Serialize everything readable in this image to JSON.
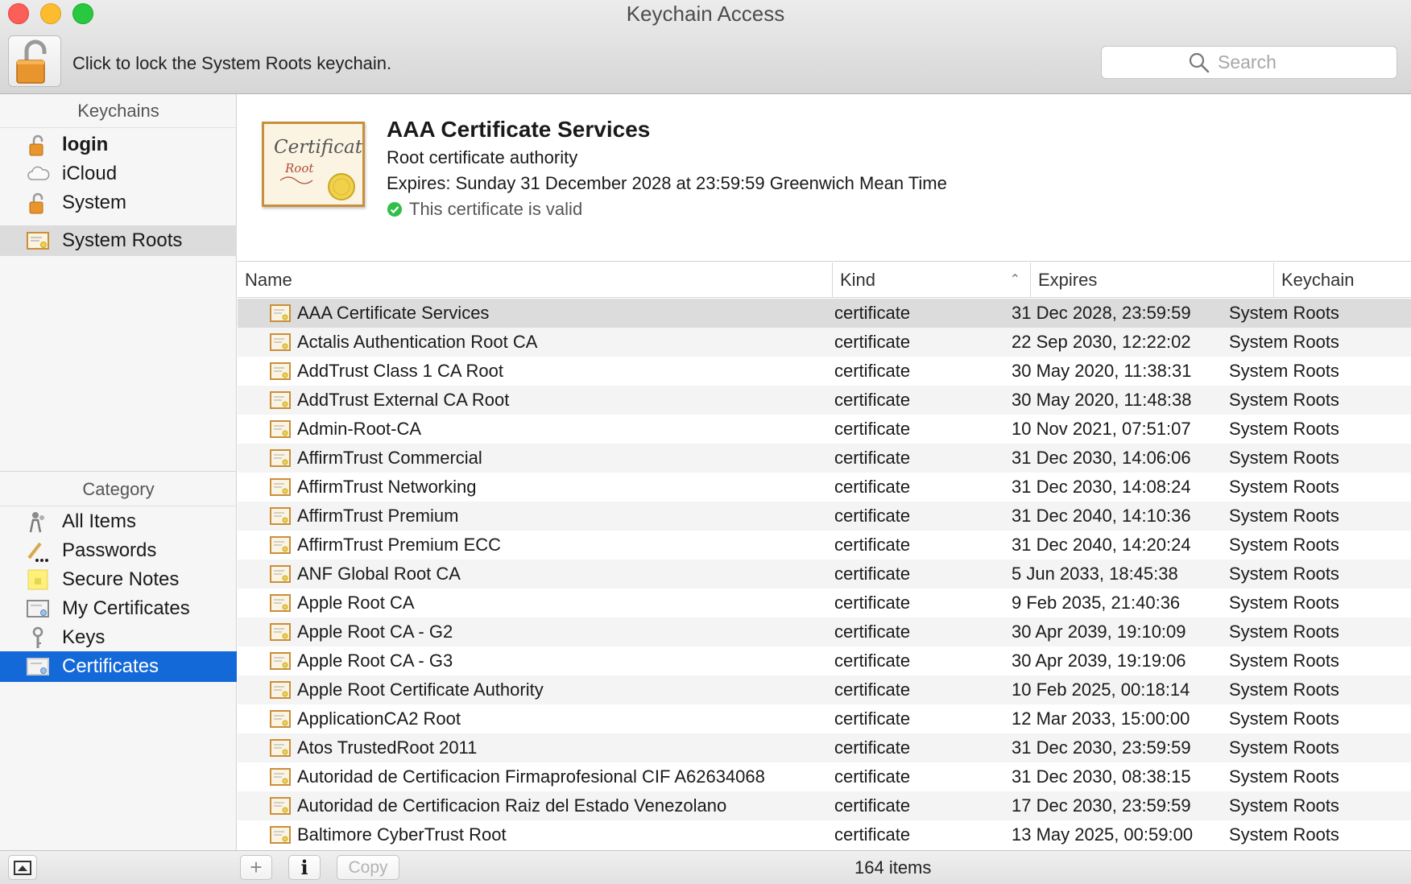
{
  "window": {
    "title": "Keychain Access"
  },
  "toolbar": {
    "lock_hint": "Click to lock the System Roots keychain.",
    "search_placeholder": "Search"
  },
  "sidebar": {
    "keychains_header": "Keychains",
    "keychains": [
      {
        "label": "login",
        "icon": "lock-open-icon"
      },
      {
        "label": "iCloud",
        "icon": "cloud-icon"
      },
      {
        "label": "System",
        "icon": "lock-open-icon"
      },
      {
        "label": "System Roots",
        "icon": "certificate-icon"
      }
    ],
    "category_header": "Category",
    "categories": [
      {
        "label": "All Items",
        "icon": "people-icon"
      },
      {
        "label": "Passwords",
        "icon": "pencil-icon"
      },
      {
        "label": "Secure Notes",
        "icon": "note-icon"
      },
      {
        "label": "My Certificates",
        "icon": "certificate-icon"
      },
      {
        "label": "Keys",
        "icon": "key-icon"
      },
      {
        "label": "Certificates",
        "icon": "certificate-icon"
      }
    ]
  },
  "detail": {
    "title": "AAA Certificate Services",
    "subtitle": "Root certificate authority",
    "expires": "Expires: Sunday 31 December 2028 at 23:59:59 Greenwich Mean Time",
    "status": "This certificate is valid",
    "status_color": "#2fbf4a",
    "cert_image_text": "Certificate Root"
  },
  "table": {
    "columns": [
      "Name",
      "Kind",
      "Expires",
      "Keychain"
    ],
    "sorted_by": "Kind",
    "rows": [
      {
        "name": "AAA Certificate Services",
        "kind": "certificate",
        "expires": "31 Dec 2028, 23:59:59",
        "keychain": "System Roots"
      },
      {
        "name": "Actalis Authentication Root CA",
        "kind": "certificate",
        "expires": "22 Sep 2030, 12:22:02",
        "keychain": "System Roots"
      },
      {
        "name": "AddTrust Class 1 CA Root",
        "kind": "certificate",
        "expires": "30 May 2020, 11:38:31",
        "keychain": "System Roots"
      },
      {
        "name": "AddTrust External CA Root",
        "kind": "certificate",
        "expires": "30 May 2020, 11:48:38",
        "keychain": "System Roots"
      },
      {
        "name": "Admin-Root-CA",
        "kind": "certificate",
        "expires": "10 Nov 2021, 07:51:07",
        "keychain": "System Roots"
      },
      {
        "name": "AffirmTrust Commercial",
        "kind": "certificate",
        "expires": "31 Dec 2030, 14:06:06",
        "keychain": "System Roots"
      },
      {
        "name": "AffirmTrust Networking",
        "kind": "certificate",
        "expires": "31 Dec 2030, 14:08:24",
        "keychain": "System Roots"
      },
      {
        "name": "AffirmTrust Premium",
        "kind": "certificate",
        "expires": "31 Dec 2040, 14:10:36",
        "keychain": "System Roots"
      },
      {
        "name": "AffirmTrust Premium ECC",
        "kind": "certificate",
        "expires": "31 Dec 2040, 14:20:24",
        "keychain": "System Roots"
      },
      {
        "name": "ANF Global Root CA",
        "kind": "certificate",
        "expires": "5 Jun 2033, 18:45:38",
        "keychain": "System Roots"
      },
      {
        "name": "Apple Root CA",
        "kind": "certificate",
        "expires": "9 Feb 2035, 21:40:36",
        "keychain": "System Roots"
      },
      {
        "name": "Apple Root CA - G2",
        "kind": "certificate",
        "expires": "30 Apr 2039, 19:10:09",
        "keychain": "System Roots"
      },
      {
        "name": "Apple Root CA - G3",
        "kind": "certificate",
        "expires": "30 Apr 2039, 19:19:06",
        "keychain": "System Roots"
      },
      {
        "name": "Apple Root Certificate Authority",
        "kind": "certificate",
        "expires": "10 Feb 2025, 00:18:14",
        "keychain": "System Roots"
      },
      {
        "name": "ApplicationCA2 Root",
        "kind": "certificate",
        "expires": "12 Mar 2033, 15:00:00",
        "keychain": "System Roots"
      },
      {
        "name": "Atos TrustedRoot 2011",
        "kind": "certificate",
        "expires": "31 Dec 2030, 23:59:59",
        "keychain": "System Roots"
      },
      {
        "name": "Autoridad de Certificacion Firmaprofesional CIF A62634068",
        "kind": "certificate",
        "expires": "31 Dec 2030, 08:38:15",
        "keychain": "System Roots"
      },
      {
        "name": "Autoridad de Certificacion Raiz del Estado Venezolano",
        "kind": "certificate",
        "expires": "17 Dec 2030, 23:59:59",
        "keychain": "System Roots"
      },
      {
        "name": "Baltimore CyberTrust Root",
        "kind": "certificate",
        "expires": "13 May 2025, 00:59:00",
        "keychain": "System Roots"
      }
    ]
  },
  "bottombar": {
    "add_label": "+",
    "info_label": "i",
    "copy_label": "Copy",
    "item_count": "164 items"
  },
  "colors": {
    "selection_blue": "#1469d8",
    "selection_gray": "#dcdcdc"
  }
}
